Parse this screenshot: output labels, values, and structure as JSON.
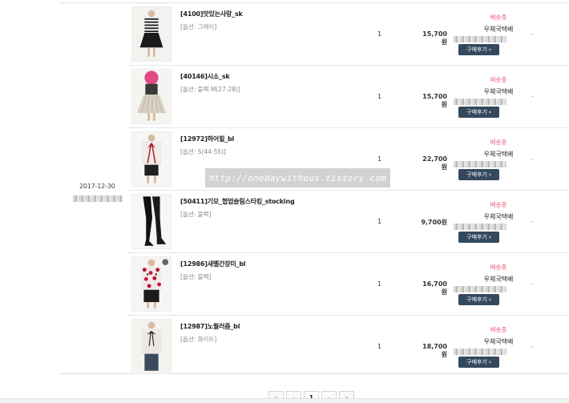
{
  "order": {
    "date": "2017-12-30"
  },
  "items": [
    {
      "name": "[4100]맛있는사랑_sk",
      "option": "[옵션: 그레이]",
      "qty": "1",
      "price": "15,700원",
      "status": "배송중",
      "carrier": "우체국택배",
      "review_label": "구매후기",
      "dash": "-",
      "thumb_icon": "striped-top-black-skirt"
    },
    {
      "name": "[40146]시소_sk",
      "option": "[옵션: 블랙 M(27-28)]",
      "qty": "1",
      "price": "15,700원",
      "status": "배송중",
      "carrier": "우체국택배",
      "review_label": "구매후기",
      "dash": "-",
      "thumb_icon": "pleated-skirt"
    },
    {
      "name": "[12972]하어힐_bl",
      "option": "[옵션: S(44-55)]",
      "qty": "1",
      "price": "22,700원",
      "status": "배송중",
      "carrier": "우체국택배",
      "review_label": "구매후기",
      "dash": "-",
      "thumb_icon": "ribbon-blouse"
    },
    {
      "name": "[50411]기모_협업슬림스타킹_stocking",
      "option": "[옵션: 블랙]",
      "qty": "1",
      "price": "9,700원",
      "status": "배송중",
      "carrier": "우체국택배",
      "review_label": "구매후기",
      "dash": "-",
      "thumb_icon": "black-stocking"
    },
    {
      "name": "[12986]새벨간장미_bl",
      "option": "[옵션: 블랙]",
      "qty": "1",
      "price": "16,700원",
      "status": "배송중",
      "carrier": "우체국택배",
      "review_label": "구매후기",
      "dash": "-",
      "thumb_icon": "floral-blouse"
    },
    {
      "name": "[12987]노월러즘_bl",
      "option": "[옵션: 화이트]",
      "qty": "1",
      "price": "18,700원",
      "status": "배송중",
      "carrier": "우체국택배",
      "review_label": "구매후기",
      "dash": "-",
      "thumb_icon": "bow-blouse"
    }
  ],
  "watermark": "http://onedaywithous.tistory.com",
  "pagination": {
    "first": "«",
    "prev": "‹",
    "current": "1",
    "next": "›",
    "last": "»"
  },
  "colors": {
    "status": "#ec5f7c",
    "button": "#34495e"
  }
}
